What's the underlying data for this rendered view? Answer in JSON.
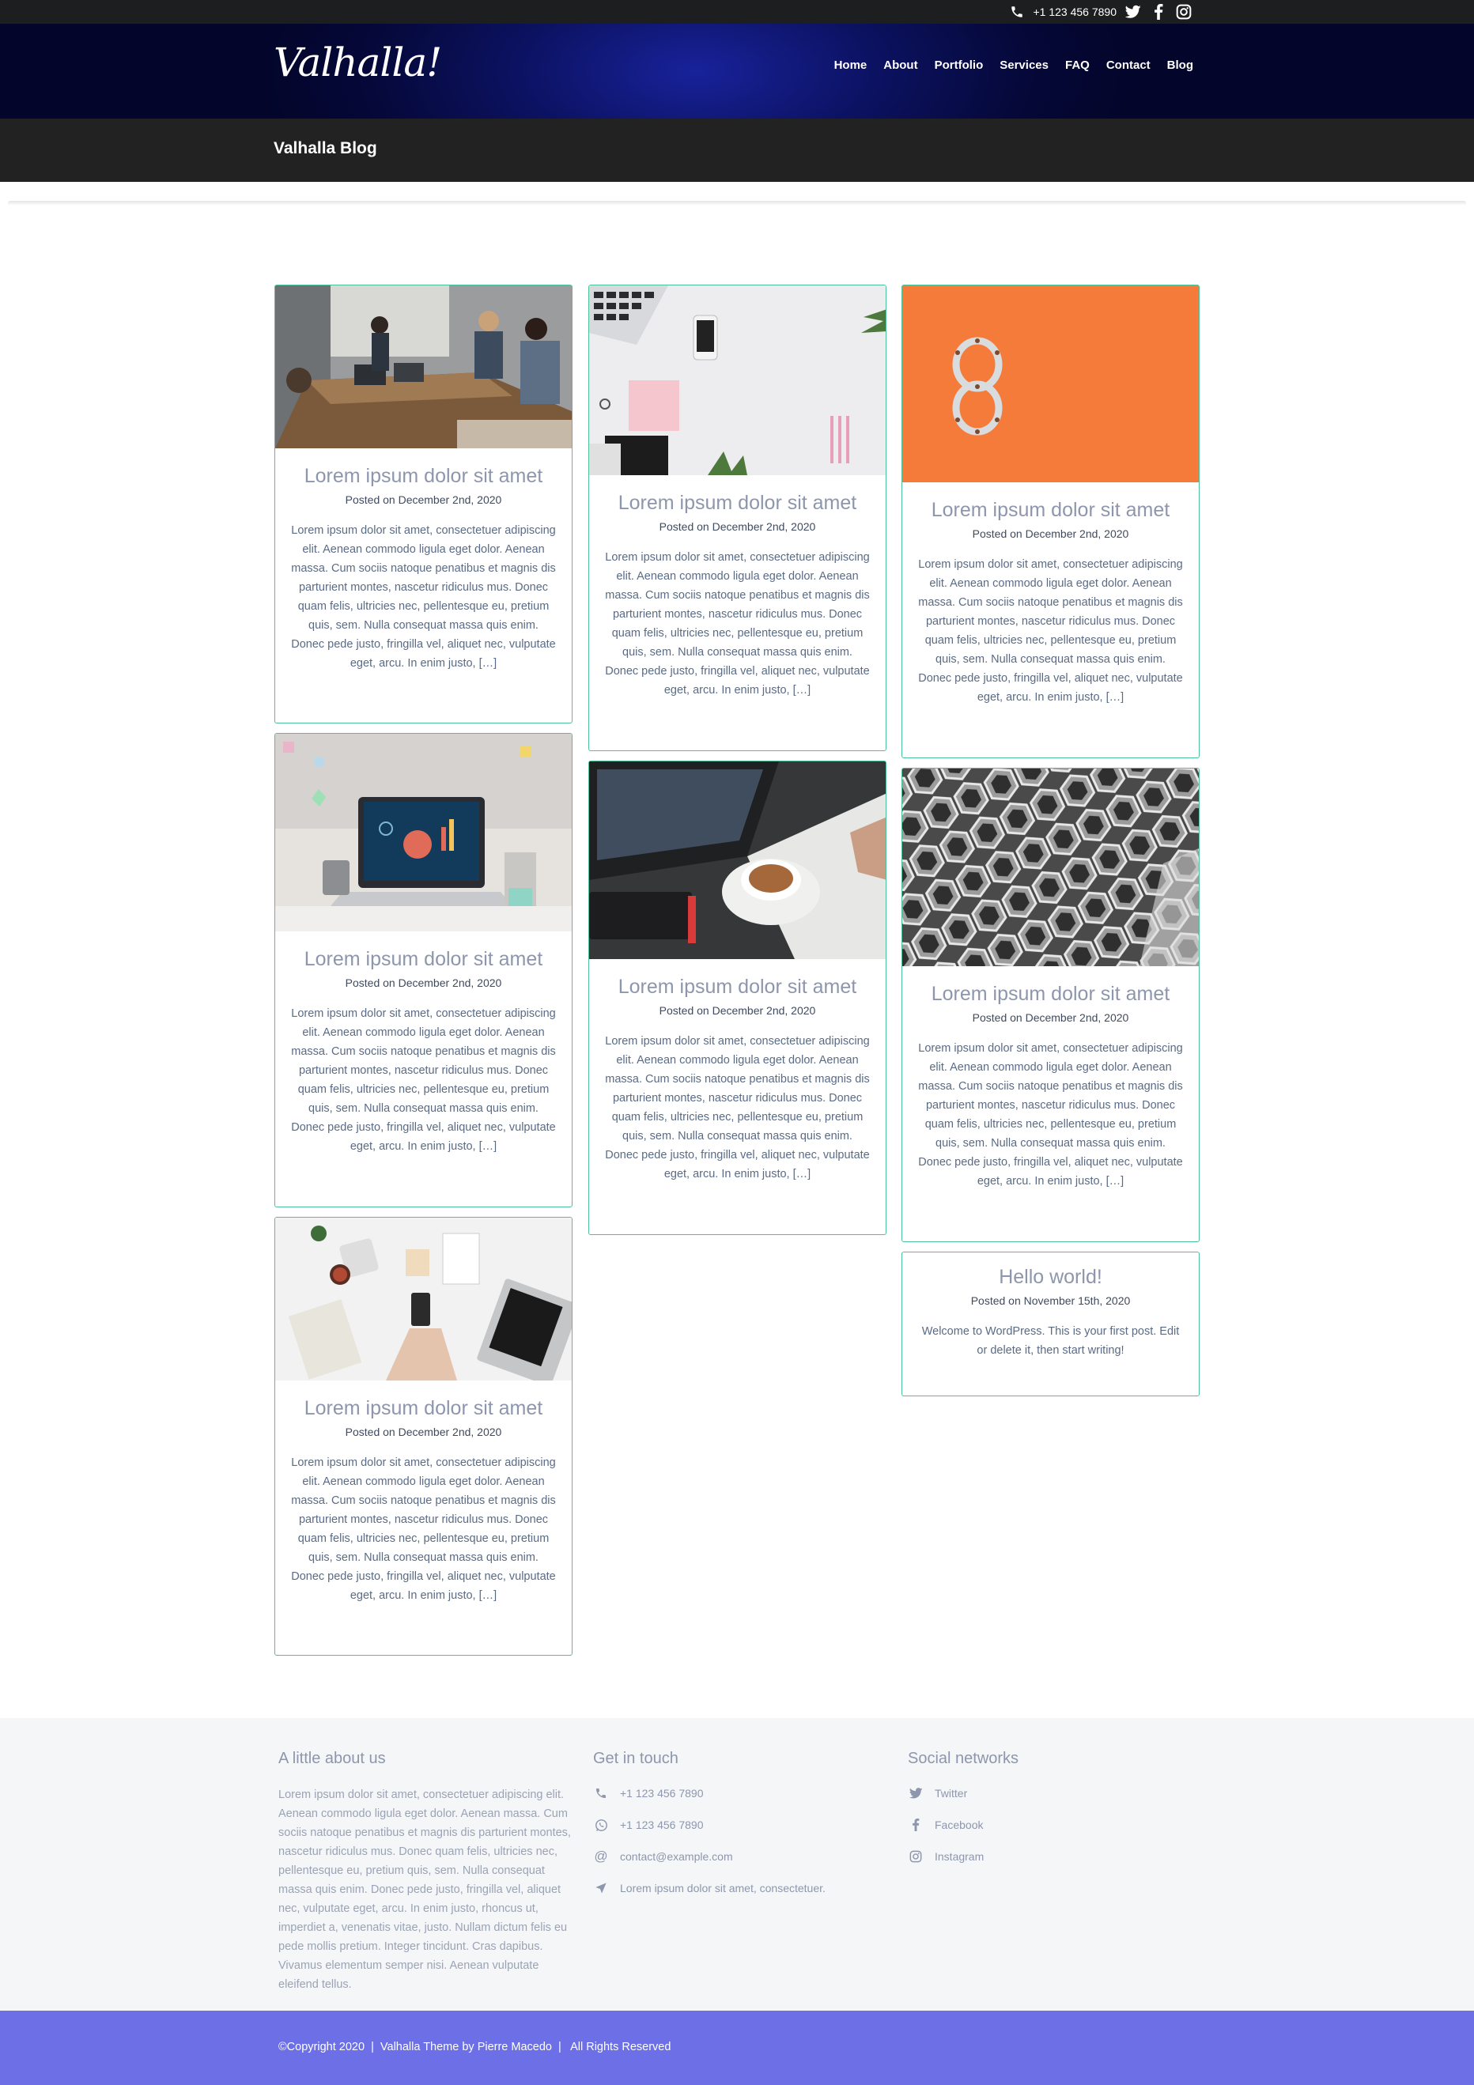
{
  "topbar": {
    "phone": "+1 123 456 7890",
    "icons": [
      "phone-icon",
      "twitter-icon",
      "facebook-icon",
      "instagram-icon"
    ]
  },
  "header": {
    "logo": "Valhalla!",
    "nav": [
      "Home",
      "About",
      "Portfolio",
      "Services",
      "FAQ",
      "Contact",
      "Blog"
    ]
  },
  "page": {
    "title": "Valhalla Blog"
  },
  "posts": [
    {
      "title": "Lorem ipsum dolor sit amet",
      "date": "Posted on December 2nd, 2020",
      "excerpt": "Lorem ipsum dolor sit amet, consectetuer adipiscing elit. Aenean commodo ligula eget dolor. Aenean massa. Cum sociis natoque penatibus et magnis dis parturient montes, nascetur ridiculus mus. Donec quam felis, ultricies nec, pellentesque eu, pretium quis, sem. Nulla consequat massa quis enim. Donec pede justo, fringilla vel, aliquet nec, vulputate eget, arcu. In enim justo, […]",
      "image": "meeting-room-photo"
    },
    {
      "title": "Lorem ipsum dolor sit amet",
      "date": "Posted on December 2nd, 2020",
      "excerpt": "Lorem ipsum dolor sit amet, consectetuer adipiscing elit. Aenean commodo ligula eget dolor. Aenean massa. Cum sociis natoque penatibus et magnis dis parturient montes, nascetur ridiculus mus. Donec quam felis, ultricies nec, pellentesque eu, pretium quis, sem. Nulla consequat massa quis enim. Donec pede justo, fringilla vel, aliquet nec, vulputate eget, arcu. In enim justo, […]",
      "image": "desk-flatlay-photo"
    },
    {
      "title": "Lorem ipsum dolor sit amet",
      "date": "Posted on December 2nd, 2020",
      "excerpt": "Lorem ipsum dolor sit amet, consectetuer adipiscing elit. Aenean commodo ligula eget dolor. Aenean massa. Cum sociis natoque penatibus et magnis dis parturient montes, nascetur ridiculus mus. Donec quam felis, ultricies nec, pellentesque eu, pretium quis, sem. Nulla consequat massa quis enim. Donec pede justo, fringilla vel, aliquet nec, vulputate eget, arcu. In enim justo, […]",
      "image": "orange-chain-photo"
    },
    {
      "title": "Lorem ipsum dolor sit amet",
      "date": "Posted on December 2nd, 2020",
      "excerpt": "Lorem ipsum dolor sit amet, consectetuer adipiscing elit. Aenean commodo ligula eget dolor. Aenean massa. Cum sociis natoque penatibus et magnis dis parturient montes, nascetur ridiculus mus. Donec quam felis, ultricies nec, pellentesque eu, pretium quis, sem. Nulla consequat massa quis enim. Donec pede justo, fringilla vel, aliquet nec, vulputate eget, arcu. In enim justo, […]",
      "image": "laptop-dashboard-photo"
    },
    {
      "title": "Lorem ipsum dolor sit amet",
      "date": "Posted on December 2nd, 2020",
      "excerpt": "Lorem ipsum dolor sit amet, consectetuer adipiscing elit. Aenean commodo ligula eget dolor. Aenean massa. Cum sociis natoque penatibus et magnis dis parturient montes, nascetur ridiculus mus. Donec quam felis, ultricies nec, pellentesque eu, pretium quis, sem. Nulla consequat massa quis enim. Donec pede justo, fringilla vel, aliquet nec, vulputate eget, arcu. In enim justo, […]",
      "image": "laptop-coffee-photo"
    },
    {
      "title": "Lorem ipsum dolor sit amet",
      "date": "Posted on December 2nd, 2020",
      "excerpt": "Lorem ipsum dolor sit amet, consectetuer adipiscing elit. Aenean commodo ligula eget dolor. Aenean massa. Cum sociis natoque penatibus et magnis dis parturient montes, nascetur ridiculus mus. Donec quam felis, ultricies nec, pellentesque eu, pretium quis, sem. Nulla consequat massa quis enim. Donec pede justo, fringilla vel, aliquet nec, vulputate eget, arcu. In enim justo, […]",
      "image": "hexagon-building-photo"
    },
    {
      "title": "Lorem ipsum dolor sit amet",
      "date": "Posted on December 2nd, 2020",
      "excerpt": "Lorem ipsum dolor sit amet, consectetuer adipiscing elit. Aenean commodo ligula eget dolor. Aenean massa. Cum sociis natoque penatibus et magnis dis parturient montes, nascetur ridiculus mus. Donec quam felis, ultricies nec, pellentesque eu, pretium quis, sem. Nulla consequat massa quis enim. Donec pede justo, fringilla vel, aliquet nec, vulputate eget, arcu. In enim justo, […]",
      "image": "workspace-phone-photo"
    },
    {
      "title": "Hello world!",
      "date": "Posted on November 15th, 2020",
      "excerpt": "Welcome to WordPress. This is your first post. Edit or delete it, then start writing!"
    }
  ],
  "footer": {
    "about_heading": "A little about us",
    "about_text": "Lorem ipsum dolor sit amet, consectetuer adipiscing elit. Aenean commodo ligula eget dolor. Aenean massa. Cum sociis natoque penatibus et magnis dis parturient montes, nascetur ridiculus mus. Donec quam felis, ultricies nec, pellentesque eu, pretium quis, sem. Nulla consequat massa quis enim. Donec pede justo, fringilla vel, aliquet nec, vulputate eget, arcu. In enim justo, rhoncus ut, imperdiet a, venenatis vitae, justo. Nullam dictum felis eu pede mollis pretium. Integer tincidunt. Cras dapibus. Vivamus elementum semper nisi. Aenean vulputate eleifend tellus.",
    "contact_heading": "Get in touch",
    "contact": [
      {
        "icon": "phone-icon",
        "text": "+1 123 456 7890"
      },
      {
        "icon": "whatsapp-icon",
        "text": "+1 123 456 7890"
      },
      {
        "icon": "at-icon",
        "text": "contact@example.com"
      },
      {
        "icon": "location-arrow-icon",
        "text": "Lorem ipsum dolor sit amet, consectetuer."
      }
    ],
    "social_heading": "Social networks",
    "social": [
      {
        "icon": "twitter-icon",
        "text": "Twitter"
      },
      {
        "icon": "facebook-icon",
        "text": "Facebook"
      },
      {
        "icon": "instagram-icon",
        "text": "Instagram"
      }
    ],
    "copyright": "©Copyright 2020  |  Valhalla Theme by Pierre Macedo  |   All Rights Reserved"
  },
  "colors": {
    "card_border": "#4cc29a",
    "copyright_bg": "#6c6fe6",
    "title_band": "#222222",
    "topbar": "#1d1e20"
  }
}
